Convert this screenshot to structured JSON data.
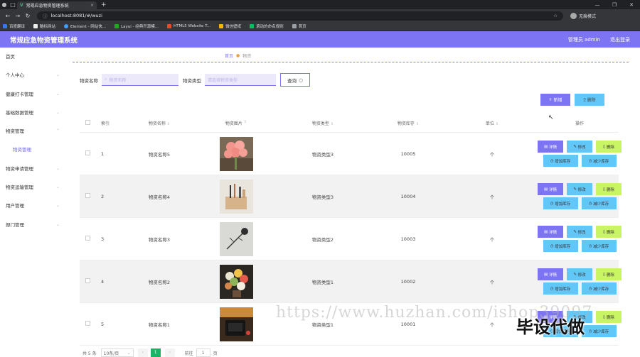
{
  "browser": {
    "tab_title": "常规应急物资管理系统",
    "url": "localhost:8081/#/wuzi",
    "profile": "无痕模式",
    "bookmarks": [
      "百度翻译",
      "酷标网站",
      "Element - 网站快...",
      "Layui - 经典开源模...",
      "HTML5 Website T...",
      "微信壁纸",
      "滚动的命名规则",
      "首页"
    ]
  },
  "header": {
    "title": "常规应急物资管理系统",
    "user": "管理员 admin",
    "logout": "退出登录"
  },
  "sidebar": {
    "items": [
      {
        "label": "首页"
      },
      {
        "label": "个人中心"
      },
      {
        "label": "健康打卡管理"
      },
      {
        "label": "基础数据管理"
      },
      {
        "label": "物资管理"
      },
      {
        "label": "物资管理"
      },
      {
        "label": "物资申请管理"
      },
      {
        "label": "物资运输管理"
      },
      {
        "label": "用户管理"
      },
      {
        "label": "部门管理"
      }
    ]
  },
  "breadcrumb": {
    "home": "首页",
    "current": "物资"
  },
  "search": {
    "name_label": "物资名称",
    "name_placeholder": "物资名称",
    "type_label": "物资类型",
    "type_placeholder": "请选择物资类型",
    "button": "查询"
  },
  "actions": {
    "add": "新增",
    "delete": "删除"
  },
  "table": {
    "headers": {
      "index": "索引",
      "name": "物资名称",
      "image": "物资图片",
      "type": "物资类型",
      "stock": "物资库存",
      "unit": "单位",
      "ops": "操作"
    },
    "rows": [
      {
        "index": "1",
        "name": "物资名称5",
        "type": "物资类型3",
        "stock": "10005",
        "unit": "个"
      },
      {
        "index": "2",
        "name": "物资名称4",
        "type": "物资类型3",
        "stock": "10004",
        "unit": "个"
      },
      {
        "index": "3",
        "name": "物资名称3",
        "type": "物资类型2",
        "stock": "10003",
        "unit": "个"
      },
      {
        "index": "4",
        "name": "物资名称2",
        "type": "物资类型1",
        "stock": "10002",
        "unit": "个"
      },
      {
        "index": "5",
        "name": "物资名称1",
        "type": "物资类型1",
        "stock": "10001",
        "unit": "个"
      }
    ],
    "ops": {
      "detail": "详情",
      "edit": "修改",
      "delete": "删除",
      "increase": "增加库存",
      "decrease": "减少库存"
    }
  },
  "pager": {
    "total": "共 5 条",
    "page_size": "10条/页",
    "current_page": "1",
    "goto_label": "前往",
    "goto_value": "1",
    "goto_suffix": "页"
  },
  "watermark": {
    "url": "https://www.huzhan.com/ishop39097",
    "text": "毕设代做"
  }
}
